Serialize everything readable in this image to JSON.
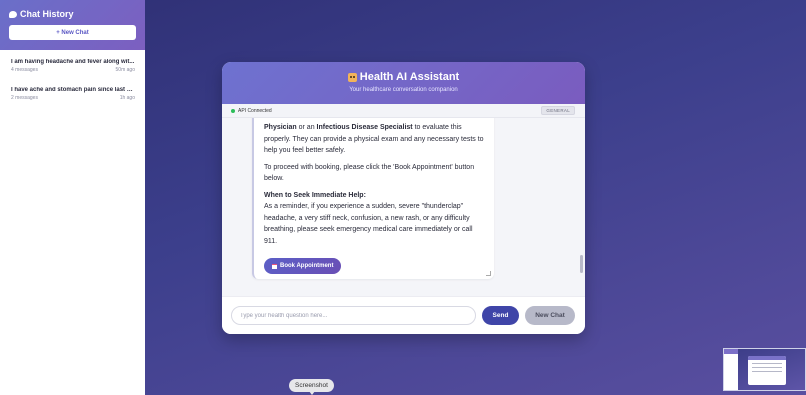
{
  "sidebar": {
    "title": "Chat History",
    "new_chat_label": "+ New Chat",
    "items": [
      {
        "title": "I am having headache and fever along wit...",
        "count": "4 messages",
        "time": "50m ago"
      },
      {
        "title": "I have ache and stomach pain since last n...",
        "count": "2 messages",
        "time": "1h ago"
      }
    ]
  },
  "main": {
    "title": "Health AI Assistant",
    "subtitle": "Your healthcare conversation companion",
    "status": "API Connected",
    "badge": "GENERAL",
    "message": {
      "p1_b1": "Physician",
      "p1_t1": " or an ",
      "p1_b2": "Infectious Disease Specialist",
      "p1_t2": " to evaluate this properly. They can provide a physical exam and any necessary tests to help you feel better safely.",
      "p2": "To proceed with booking, please click the 'Book Appointment' button below.",
      "p3_heading": "When to Seek Immediate Help:",
      "p3_body": "As a reminder, if you experience a sudden, severe \"thunderclap\" headache, a very stiff neck, confusion, a new rash, or any difficulty breathing, please seek emergency medical care immediately or call 911.",
      "book_label": "Book Appointment"
    },
    "input_placeholder": "Type your health question here...",
    "send_label": "Send",
    "new_chat_label": "New Chat"
  },
  "tooltip": "Screenshot",
  "icons": {
    "sidebar_title": "chat-bubble-icon",
    "card_title": "robot-icon",
    "book": "calendar-icon"
  },
  "colors": {
    "accent": "#5b5fc7",
    "status_ok": "#2dbd5a",
    "send_button": "#3f45a8"
  }
}
